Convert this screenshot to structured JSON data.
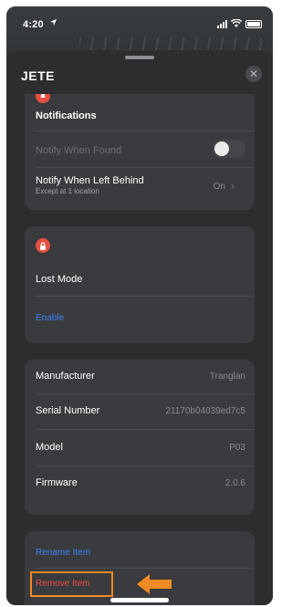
{
  "status_bar": {
    "time": "4:20",
    "location_icon": "location-arrow-icon",
    "signal_icon": "cellular-signal-icon",
    "wifi_icon": "wifi-icon",
    "battery_icon": "battery-icon"
  },
  "sheet": {
    "title": "JETE",
    "close_icon": "close-icon"
  },
  "notifications": {
    "icon": "notification-bell-icon",
    "heading": "Notifications",
    "notify_when_found": {
      "label": "Notify When Found",
      "enabled": false
    },
    "notify_left_behind": {
      "label": "Notify When Left Behind",
      "sublabel": "Except at 1 location",
      "value": "On"
    }
  },
  "lost_mode": {
    "icon": "lock-icon",
    "heading": "Lost Mode",
    "enable_label": "Enable"
  },
  "device_info": {
    "rows": [
      {
        "label": "Manufacturer",
        "value": "Tranglan"
      },
      {
        "label": "Serial Number",
        "value": "21170b04039ed7c5"
      },
      {
        "label": "Model",
        "value": "P03"
      },
      {
        "label": "Firmware",
        "value": "2.0.6"
      }
    ]
  },
  "actions": {
    "rename_label": "Rename Item",
    "remove_label": "Remove Item"
  },
  "colors": {
    "accent_blue": "#3b82f6",
    "destructive_red": "#e94e3f",
    "highlight_orange": "#f08a24"
  }
}
